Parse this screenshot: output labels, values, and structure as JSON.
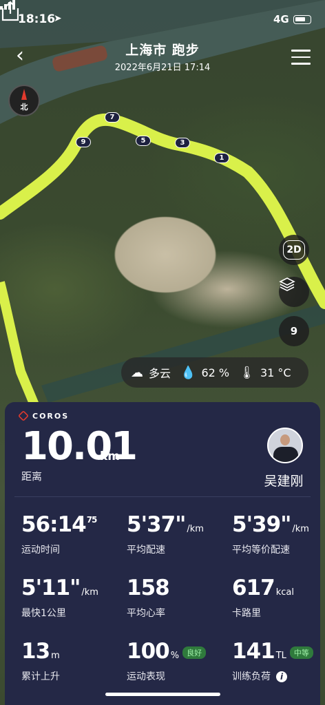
{
  "status": {
    "time": "18:16",
    "network": "4G"
  },
  "header": {
    "title": "上海市 跑步",
    "subtitle": "2022年6月21日 17:14"
  },
  "compass": {
    "label": "北"
  },
  "map_controls": {
    "mode": "2D",
    "zoom": "9"
  },
  "km_markers": [
    "7",
    "9",
    "5",
    "3",
    "1"
  ],
  "weather": {
    "condition": "多云",
    "humidity": "62 %",
    "temperature": "31 °C"
  },
  "card": {
    "brand": "COROS",
    "distance": {
      "value": "10.01",
      "unit": "km",
      "label": "距离"
    },
    "user_name": "吴建刚",
    "stats": [
      {
        "value": "56:14",
        "sup": "75",
        "unit": "",
        "label": "运动时间"
      },
      {
        "value": "5'37\"",
        "sup": "",
        "unit": "/km",
        "label": "平均配速"
      },
      {
        "value": "5'39\"",
        "sup": "",
        "unit": "/km",
        "label": "平均等价配速"
      },
      {
        "value": "5'11\"",
        "sup": "",
        "unit": "/km",
        "label": "最快1公里"
      },
      {
        "value": "158",
        "sup": "",
        "unit": "",
        "label": "平均心率"
      },
      {
        "value": "617",
        "sup": "",
        "unit": "kcal",
        "label": "卡路里"
      },
      {
        "value": "13",
        "sup": "",
        "unit": "m",
        "label": "累计上升"
      },
      {
        "value": "100",
        "sup": "",
        "unit": "%",
        "badge": "良好",
        "label": "运动表现"
      },
      {
        "value": "141",
        "sup": "",
        "unit": "TL",
        "badge": "中等",
        "label": "训练负荷"
      }
    ]
  },
  "colors": {
    "route": "#d9f04a",
    "card_bg": "#242846",
    "badge_bg": "#2f7a3c",
    "brand_red": "#e23a2d"
  }
}
